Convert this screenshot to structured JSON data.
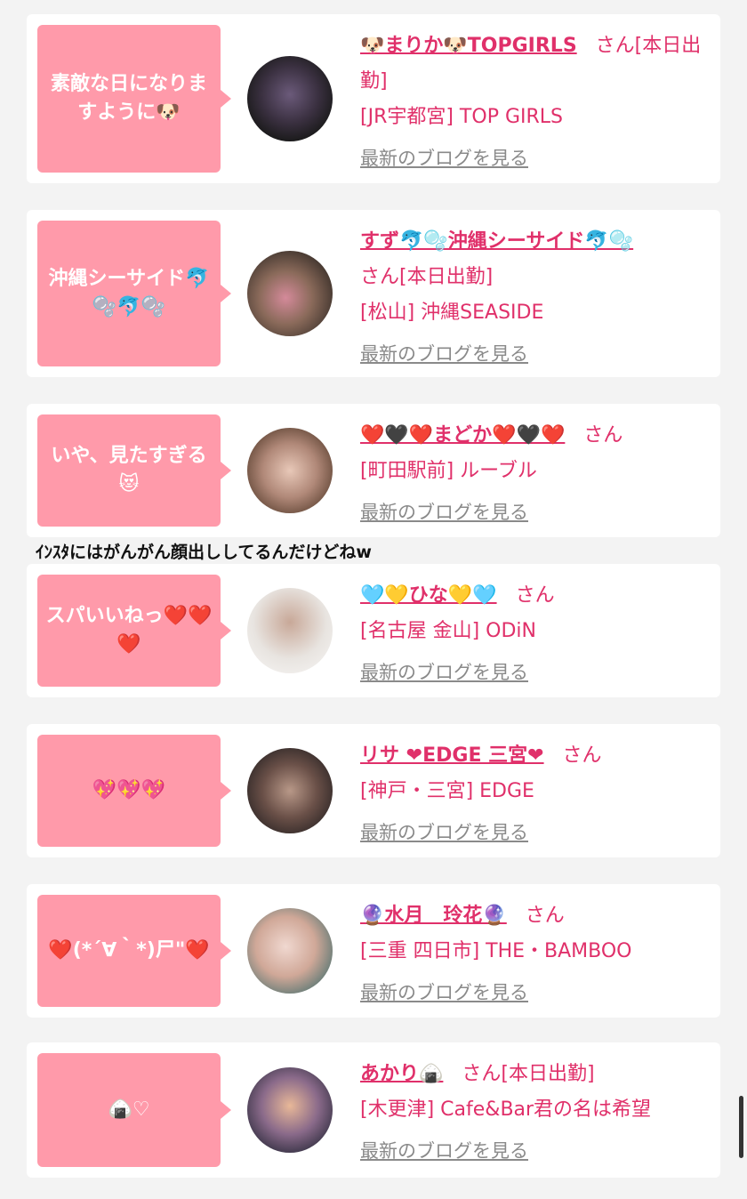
{
  "cards": [
    {
      "bubble": "素敵な日になりますように🐶",
      "name": "🐶まりか🐶TOPGIRLS",
      "suffix": "さん[本日出勤]",
      "shop": "[JR宇都宮] TOP GIRLS",
      "blog": "最新のブログを見る",
      "avatar_colors": [
        "#1a1a1a",
        "#6b5a7a"
      ]
    },
    {
      "bubble": "沖縄シーサイド🐬🫧🐬🫧",
      "name": "すず🐬🫧沖縄シーサイド🐬🫧",
      "suffix": "さん[本日出勤]",
      "shop": "[松山] 沖縄SEASIDE",
      "blog": "最新のブログを見る",
      "avatar_colors": [
        "#5a4a3a",
        "#d48a9a"
      ]
    },
    {
      "bubble": "いや、見たすぎる😻",
      "name": "❤️🖤❤️まどか❤️🖤❤️",
      "suffix": "さん",
      "shop": "[町田駅前] ルーブル",
      "blog": "最新のブログを見る",
      "avatar_colors": [
        "#8a6a5a",
        "#d8b8a8"
      ]
    },
    {
      "bubble": "スパいいねっ❤️❤️❤️",
      "name": "🩵💛ひな💛🩵",
      "suffix": "さん",
      "shop": "[名古屋 金山] ODiN",
      "blog": "最新のブログを見る",
      "avatar_colors": [
        "#e8e4e0",
        "#c8b8a8"
      ]
    },
    {
      "bubble": "💖💖💖",
      "name": "リサ ❤EDGE 三宮❤",
      "suffix": "さん",
      "shop": "[神戸・三宮] EDGE",
      "blog": "最新のブログを見る",
      "avatar_colors": [
        "#2a2424",
        "#b89888"
      ]
    },
    {
      "bubble": "❤️(*´∀｀*)尸\"❤️",
      "name": "🔮水月　玲花🔮",
      "suffix": "さん",
      "shop": "[三重 四日市] THE・BAMBOO",
      "blog": "最新のブログを見る",
      "avatar_colors": [
        "#f0d8d0",
        "#3a6a6a"
      ]
    },
    {
      "bubble": "🍙♡",
      "name": "あかり🍙",
      "suffix": "さん[本日出勤]",
      "shop": "[木更津] Cafe&Bar君の名は希望",
      "blog": "最新のブログを見る",
      "avatar_colors": [
        "#3a2a4a",
        "#d8a888"
      ]
    }
  ],
  "note": "ｲﾝｽﾀにはがんがん顔出ししてるんだけどねw"
}
